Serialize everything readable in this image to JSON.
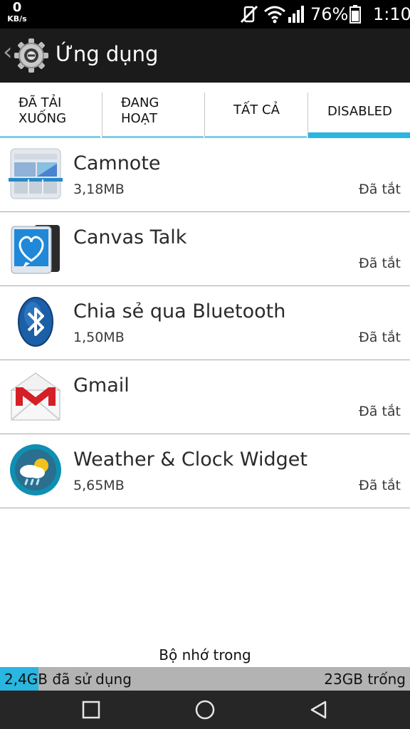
{
  "statusbar": {
    "net_value": "0",
    "net_unit": "KB/s",
    "battery_percent": "76%",
    "time": "1:10",
    "icons": [
      "vibrate-off-icon",
      "wifi-icon",
      "signal-icon",
      "battery-icon"
    ]
  },
  "actionbar": {
    "title": "Ứng dụng",
    "icons": [
      "back-chevron-icon",
      "settings-gear-icon"
    ]
  },
  "tabs": [
    {
      "line1": "ĐÃ TẢI",
      "line2": "XUỐNG",
      "active": false
    },
    {
      "line1": "ĐANG",
      "line2": "HOẠT",
      "active": false
    },
    {
      "line1": "TẤT CẢ",
      "line2": "",
      "active": false
    },
    {
      "line1": "DISABLED",
      "line2": "",
      "active": true
    }
  ],
  "apps": [
    {
      "name": "Camnote",
      "size": "3,18MB",
      "status": "Đã tắt",
      "icon": "camnote-icon"
    },
    {
      "name": "Canvas Talk",
      "size": "",
      "status": "Đã tắt",
      "icon": "canvas-talk-icon"
    },
    {
      "name": "Chia sẻ qua Bluetooth",
      "size": "1,50MB",
      "status": "Đã tắt",
      "icon": "bluetooth-icon"
    },
    {
      "name": "Gmail",
      "size": "",
      "status": "Đã tắt",
      "icon": "gmail-icon"
    },
    {
      "name": "Weather & Clock Widget",
      "size": "5,65MB",
      "status": "Đã tắt",
      "icon": "weather-icon"
    }
  ],
  "storage": {
    "title": "Bộ nhớ trong",
    "used_label": "2,4GB đã sử dụng",
    "free_label": "23GB trống",
    "used_fraction": 0.094
  },
  "navbar": {
    "icons": [
      "recent-apps-icon",
      "home-icon",
      "back-icon"
    ]
  },
  "colors": {
    "accent": "#29b6e0",
    "actionbar": "#1b1b1b",
    "navbar": "#262626"
  }
}
